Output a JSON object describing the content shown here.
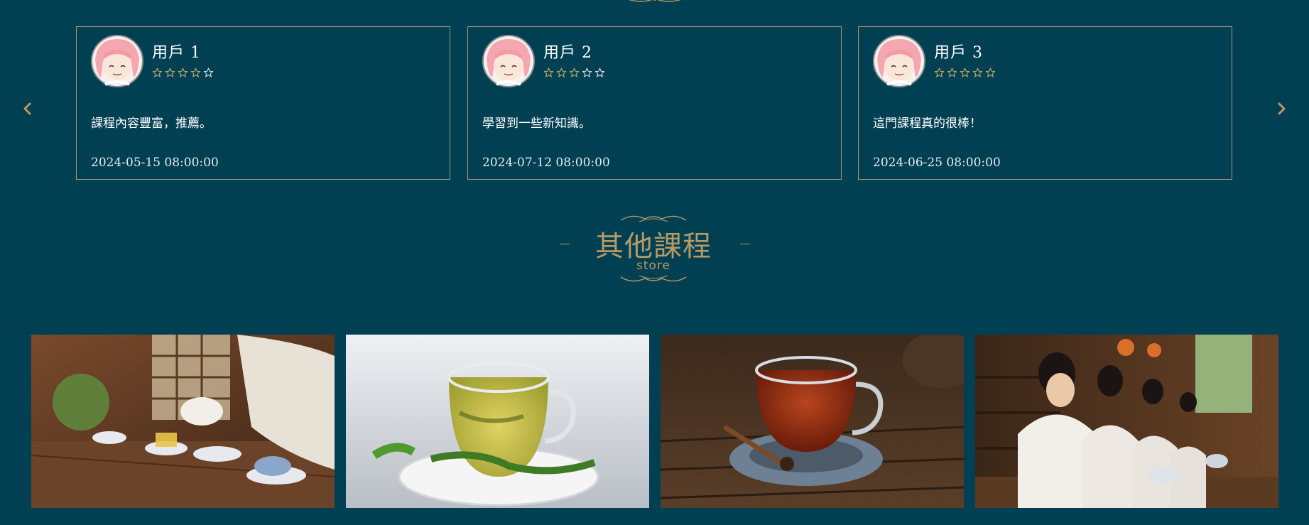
{
  "reviews": [
    {
      "user": "用戶  1",
      "rating": 5,
      "text": "課程內容豐富，推薦。",
      "date": "2024-05-15 08:00:00"
    },
    {
      "user": "用戶  2",
      "rating": 5,
      "text": "學習到一些新知識。",
      "date": "2024-07-12 08:00:00"
    },
    {
      "user": "用戶  3",
      "rating": 5,
      "text": "這門課程真的很棒！",
      "date": "2024-06-25 08:00:00"
    }
  ],
  "other_courses": {
    "title": "其他課程",
    "subtitle": "store"
  },
  "icons": {
    "prev": "chevron-left-icon",
    "next": "chevron-right-icon",
    "star": "star-outline-icon"
  },
  "colors": {
    "background": "#013f53",
    "gold": "#b79a65",
    "card_border": "#a89a76",
    "star": "#c9b36a"
  }
}
